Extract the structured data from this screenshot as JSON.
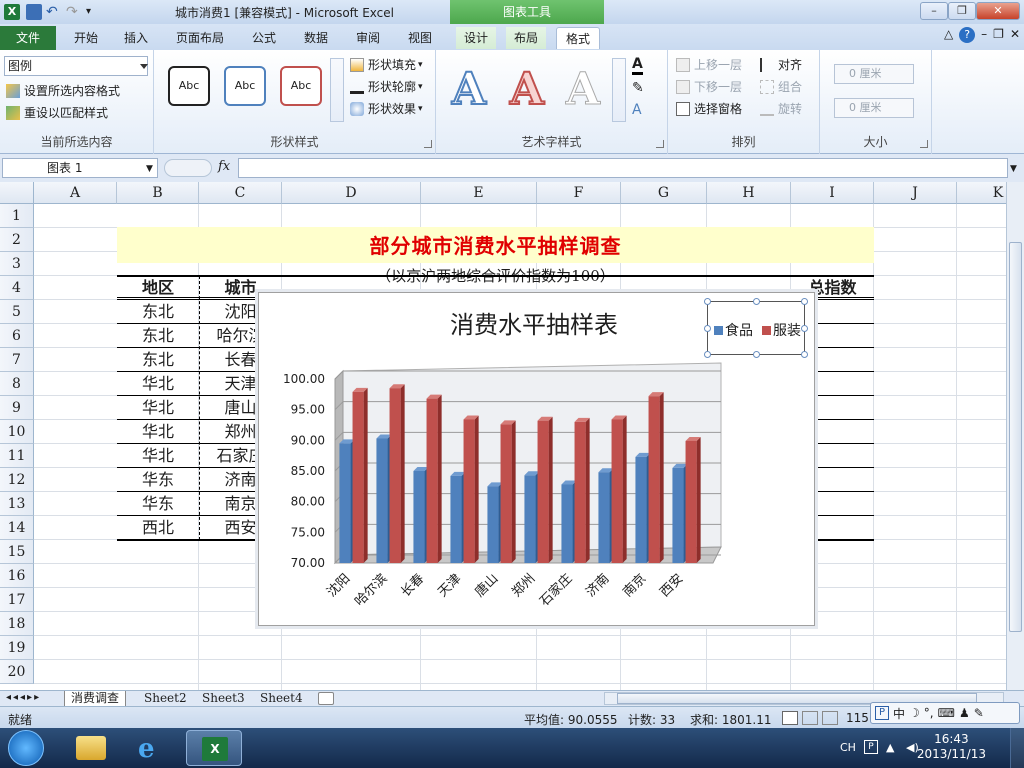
{
  "titlebar": {
    "title": "城市消费1 [兼容模式] - Microsoft Excel",
    "contextual_group": "图表工具",
    "minimize": "–",
    "restore": "❐",
    "close": "✕"
  },
  "tabs": {
    "file": "文件",
    "items": [
      "开始",
      "插入",
      "页面布局",
      "公式",
      "数据",
      "审阅",
      "视图"
    ],
    "contextual": [
      "设计",
      "布局",
      "格式"
    ],
    "active": "格式"
  },
  "ribbon": {
    "current_selection": {
      "combo_value": "图例",
      "format_selection": "设置所选内容格式",
      "reset_style": "重设以匹配样式",
      "label": "当前所选内容"
    },
    "shape_styles": {
      "samples": [
        "Abc",
        "Abc",
        "Abc"
      ],
      "fill": "形状填充",
      "outline": "形状轮廓",
      "effects": "形状效果",
      "label": "形状样式"
    },
    "wordart": {
      "sample": "A",
      "label": "艺术字样式"
    },
    "arrange": {
      "bring_forward": "上移一层",
      "send_backward": "下移一层",
      "selection_pane": "选择窗格",
      "align": "对齐",
      "group": "组合",
      "rotate": "旋转",
      "label": "排列"
    },
    "size": {
      "height": "0 厘米",
      "width": "0 厘米",
      "label": "大小"
    }
  },
  "formula_bar": {
    "name_box": "图表 1",
    "fx": "fx",
    "value": ""
  },
  "grid": {
    "columns": [
      "A",
      "B",
      "C",
      "D",
      "E",
      "F",
      "G",
      "H",
      "I",
      "J",
      "K"
    ],
    "rows": [
      "1",
      "2",
      "3",
      "4",
      "5",
      "6",
      "7",
      "8",
      "9",
      "10",
      "11",
      "12",
      "13",
      "14",
      "15",
      "16",
      "17",
      "18",
      "19",
      "20"
    ]
  },
  "sheet": {
    "title": "部分城市消费水平抽样调查",
    "subtitle": "（以京沪两地综合评价指数为100）",
    "header_region": "地区",
    "header_city": "城市",
    "header_total": "总指数",
    "regions": [
      "东北",
      "东北",
      "东北",
      "华北",
      "华北",
      "华北",
      "华北",
      "华东",
      "华东",
      "西北"
    ],
    "cities_visible": [
      "沈阳",
      "哈尔滨",
      "长春",
      "天津",
      "唐山",
      "郑州",
      "石家庄",
      "济南",
      "南京",
      "西安"
    ]
  },
  "chart_data": {
    "type": "bar",
    "title": "消费水平抽样表",
    "categories": [
      "沈阳",
      "哈尔滨",
      "长春",
      "天津",
      "唐山",
      "郑州",
      "石家庄",
      "济南",
      "南京",
      "西安"
    ],
    "series": [
      {
        "name": "食品",
        "values": [
          89.5,
          90.3,
          85.0,
          84.2,
          82.5,
          84.3,
          82.8,
          84.8,
          87.3,
          85.5
        ],
        "color": "#4f81bd"
      },
      {
        "name": "服装",
        "values": [
          97.9,
          98.5,
          96.8,
          93.4,
          92.6,
          93.2,
          93.0,
          93.4,
          97.2,
          89.9
        ],
        "color": "#c0504d"
      }
    ],
    "ylim": [
      70,
      100
    ],
    "yticks": [
      "70.00",
      "75.00",
      "80.00",
      "85.00",
      "90.00",
      "95.00",
      "100.00"
    ],
    "grid": true,
    "legend": "top-right"
  },
  "sheet_tabs": {
    "active": "消费调查",
    "others": [
      "Sheet2",
      "Sheet3",
      "Sheet4"
    ]
  },
  "status": {
    "ready": "就绪",
    "average": "平均值: 90.0555",
    "count": "计数: 33",
    "sum": "求和: 1801.11",
    "zoom": "115"
  },
  "ime": {
    "mode": "中"
  },
  "taskbar": {
    "lang": "CH",
    "time": "16:43",
    "date": "2013/11/13"
  }
}
